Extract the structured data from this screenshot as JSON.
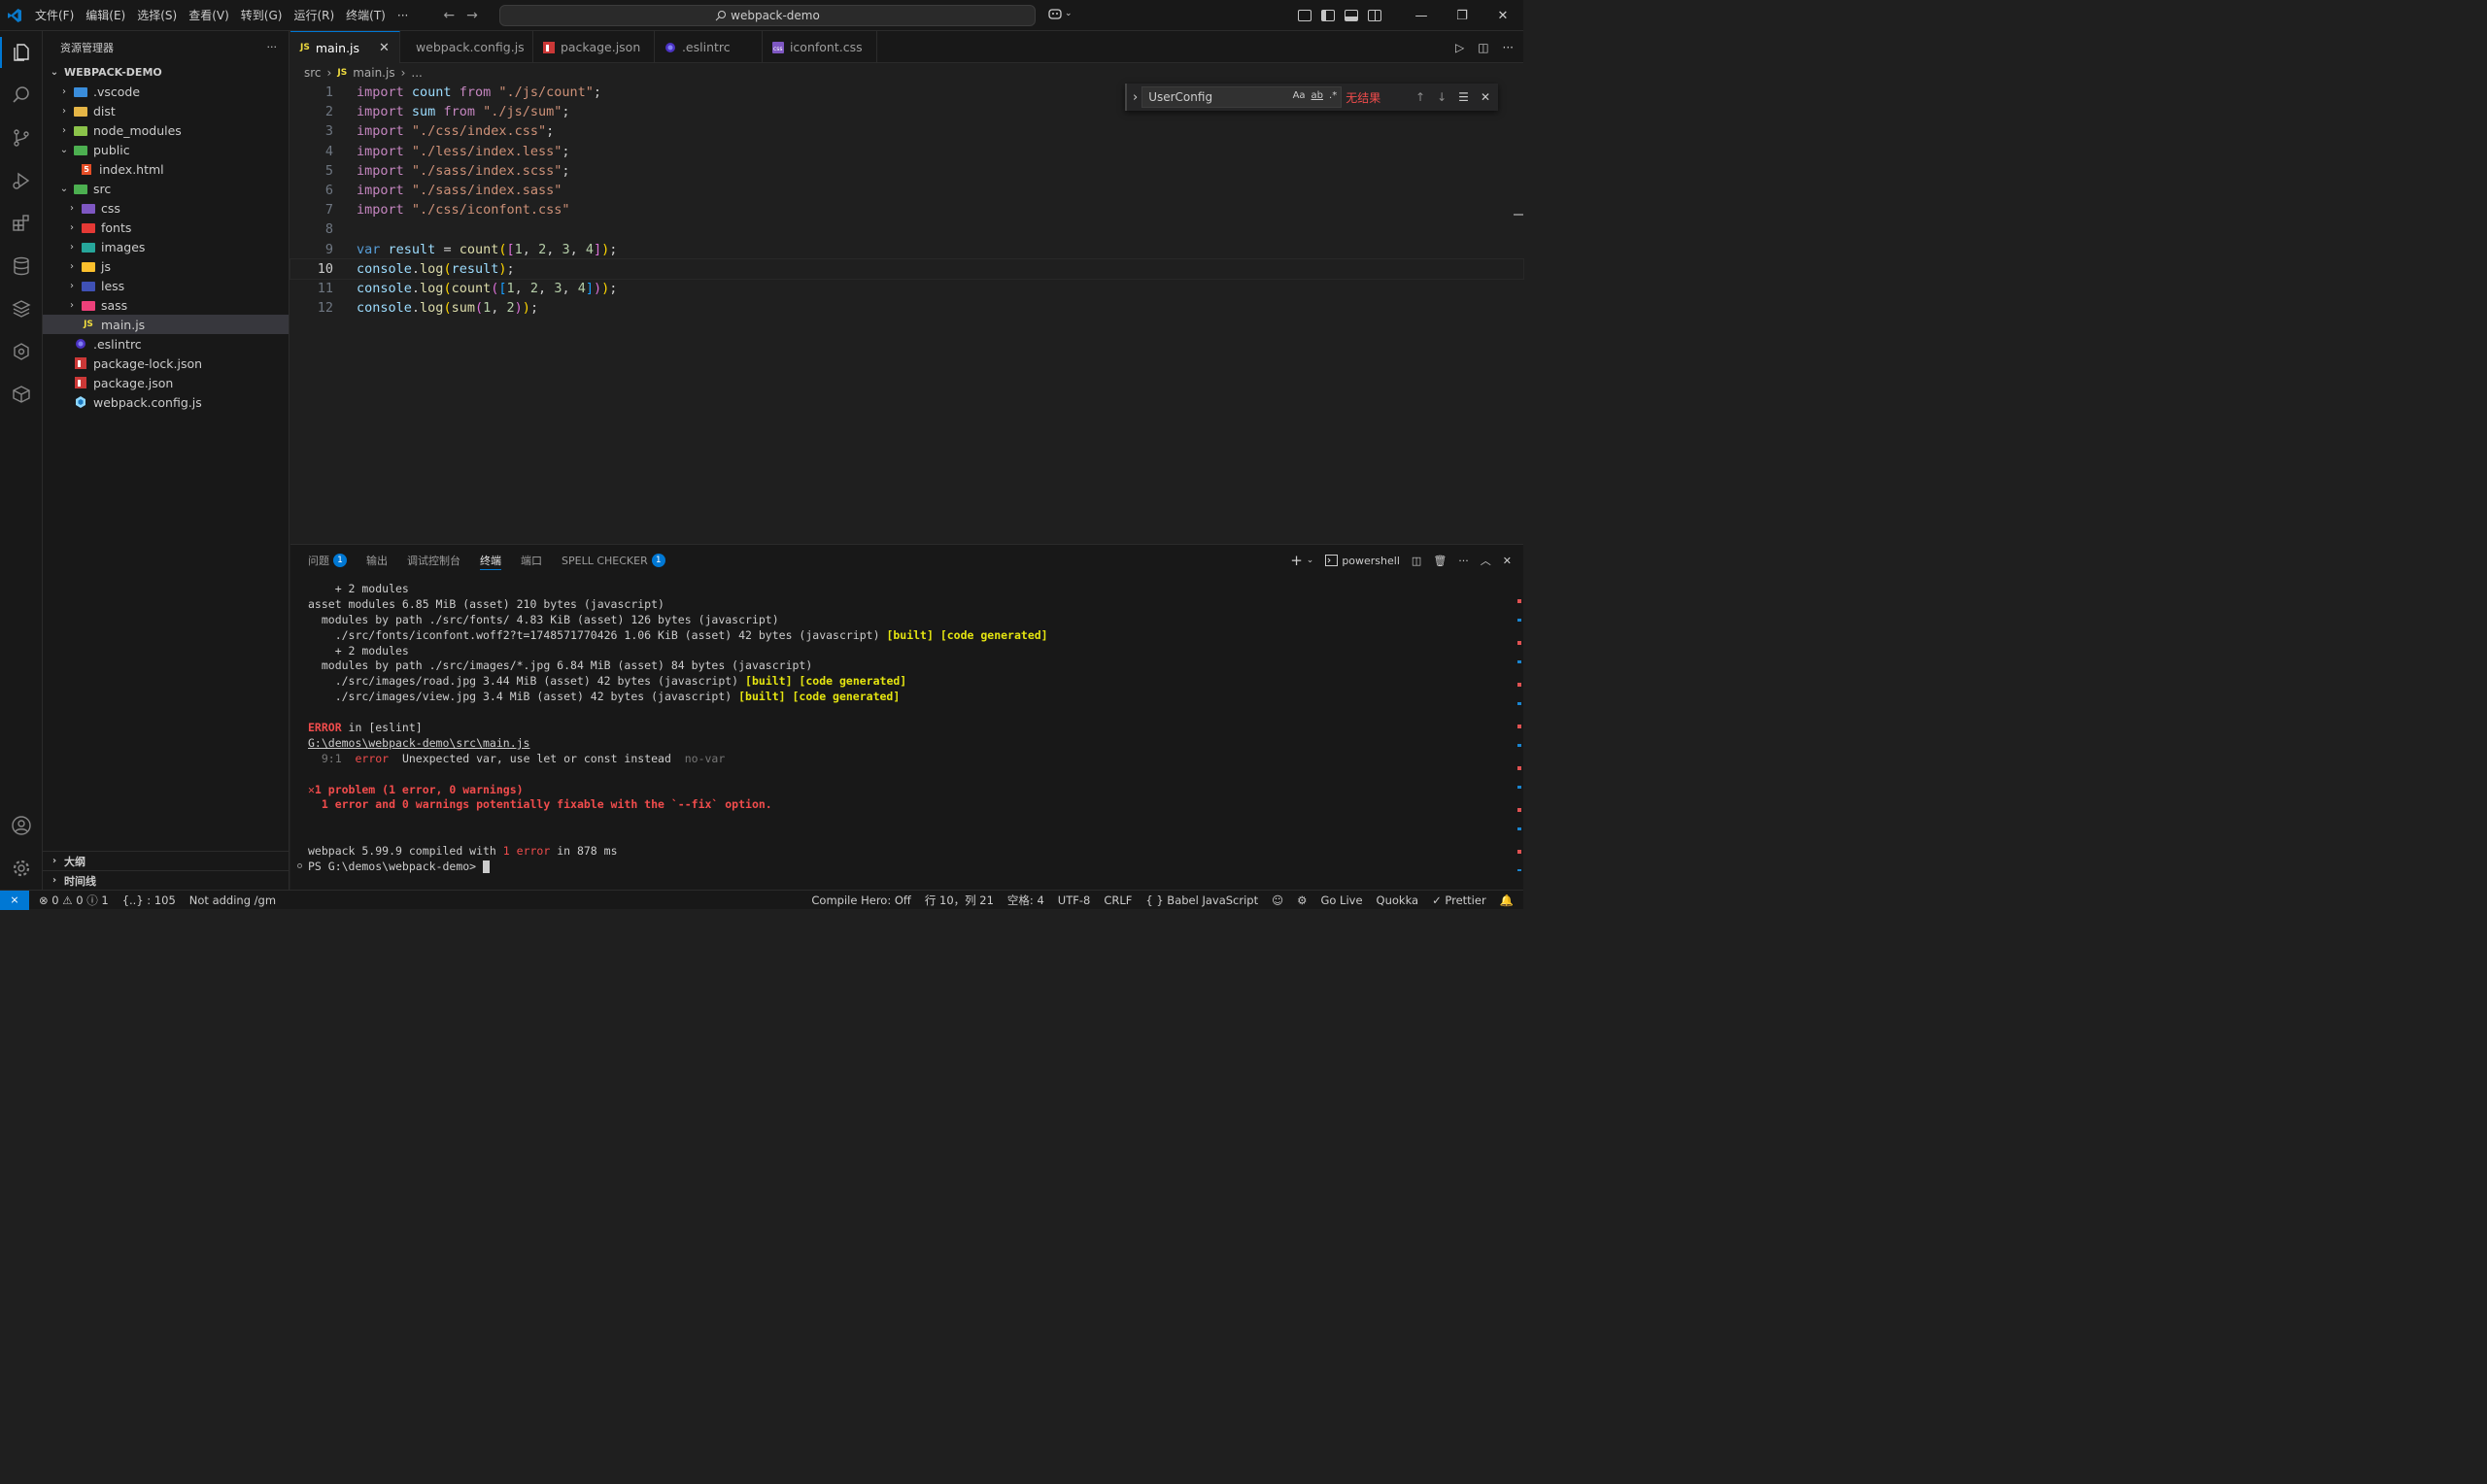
{
  "titlebar": {
    "menu": [
      "文件(F)",
      "编辑(E)",
      "选择(S)",
      "查看(V)",
      "转到(G)",
      "运行(R)",
      "终端(T)",
      "···"
    ],
    "search": "webpack-demo"
  },
  "explorer": {
    "title": "资源管理器",
    "more": "···",
    "root": "WEBPACK-DEMO",
    "items": [
      {
        "label": ".vscode",
        "chev": "›"
      },
      {
        "label": "dist",
        "chev": "›"
      },
      {
        "label": "node_modules",
        "chev": "›"
      },
      {
        "label": "public",
        "chev": "⌄"
      },
      {
        "label": "index.html",
        "chev": ""
      },
      {
        "label": "src",
        "chev": "⌄"
      },
      {
        "label": "css",
        "chev": "›"
      },
      {
        "label": "fonts",
        "chev": "›"
      },
      {
        "label": "images",
        "chev": "›"
      },
      {
        "label": "js",
        "chev": "›"
      },
      {
        "label": "less",
        "chev": "›"
      },
      {
        "label": "sass",
        "chev": "›"
      },
      {
        "label": "main.js",
        "chev": ""
      },
      {
        "label": ".eslintrc",
        "chev": ""
      },
      {
        "label": "package-lock.json",
        "chev": ""
      },
      {
        "label": "package.json",
        "chev": ""
      },
      {
        "label": "webpack.config.js",
        "chev": ""
      }
    ],
    "outline": "大纲",
    "timeline": "时间线"
  },
  "tabs": [
    "main.js",
    "webpack.config.js",
    "package.json",
    ".eslintrc",
    "iconfont.css"
  ],
  "breadcrumb": {
    "folder": "src",
    "file": "main.js",
    "more": "..."
  },
  "editor": {
    "line_numbers": [
      "1",
      "2",
      "3",
      "4",
      "5",
      "6",
      "7",
      "8",
      "9",
      "10",
      "11",
      "12"
    ],
    "current_line": 10
  },
  "find": {
    "query": "UserConfig",
    "opt_case": "Aa",
    "opt_word": "ab",
    "opt_regex": ".*",
    "no_result": "无结果"
  },
  "panel": {
    "tabs": {
      "problems": "问题",
      "problems_count": "1",
      "output": "输出",
      "debug": "调试控制台",
      "terminal": "终端",
      "ports": "端口",
      "spell": "SPELL CHECKER",
      "spell_count": "1"
    },
    "shell": "powershell"
  },
  "terminal": {
    "l1": "    + 2 modules",
    "l2": "asset modules 6.85 MiB (asset) 210 bytes (javascript)",
    "l3": "  modules by path ./src/fonts/ 4.83 KiB (asset) 126 bytes (javascript)",
    "l4a": "    ./src/fonts/iconfont.woff2?t=1748571770426 1.06 KiB (asset) 42 bytes (javascript) ",
    "l4b": "[built] [code generated]",
    "l5": "    + 2 modules",
    "l6": "  modules by path ./src/images/*.jpg 6.84 MiB (asset) 84 bytes (javascript)",
    "l7a": "    ./src/images/road.jpg 3.44 MiB (asset) 42 bytes (javascript) ",
    "l7b": "[built] [code generated]",
    "l8a": "    ./src/images/view.jpg 3.4 MiB (asset) 42 bytes (javascript) ",
    "l8b": "[built] [code generated]",
    "err_a": "ERROR",
    "err_b": " in [eslint]",
    "path": "G:\\demos\\webpack-demo\\src\\main.js",
    "det_pos": "  9:1  ",
    "det_err": "error",
    "det_msg": "  Unexpected var, use let or const instead  ",
    "det_rule": "no-var",
    "prob1": "✕1 problem (1 error, 0 warnings)",
    "prob2": "  1 error and 0 warnings potentially fixable with the `--fix` option.",
    "comp_a": "webpack 5.99.9 compiled with ",
    "comp_b": "1 error",
    "comp_c": " in 878 ms",
    "prompt": "PS G:\\demos\\webpack-demo> "
  },
  "statusbar": {
    "errors": "⊗ 0 ⚠ 0 ⓘ 1",
    "braces": "{..} : 105",
    "not_adding": "Not adding /gm",
    "compile_hero": "Compile Hero: Off",
    "position": "行 10，列 21",
    "spaces": "空格: 4",
    "encoding": "UTF-8",
    "eol": "CRLF",
    "language": "{ } Babel JavaScript",
    "go_live": "Go Live",
    "quokka": "Quokka",
    "prettier": "✓ Prettier"
  }
}
